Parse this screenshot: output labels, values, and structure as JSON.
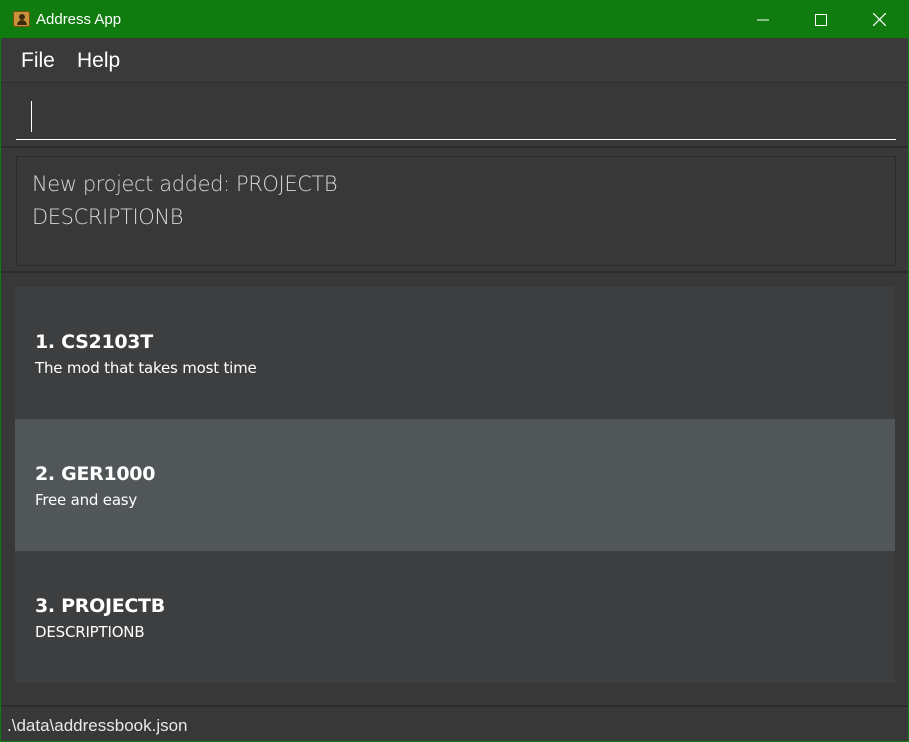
{
  "window": {
    "title": "Address App",
    "accent_color": "#107c10",
    "icons": {
      "app": "contact-book-icon",
      "minimize": "minimize-icon",
      "maximize": "maximize-icon",
      "close": "close-icon"
    }
  },
  "menu": {
    "file_label": "File",
    "help_label": "Help"
  },
  "command": {
    "value": "",
    "placeholder": ""
  },
  "result": {
    "message": "New project added: PROJECTB\nDESCRIPTIONB"
  },
  "projects": [
    {
      "title": "1.  CS2103T",
      "description": "The mod that takes most time"
    },
    {
      "title": "2.  GER1000",
      "description": "Free and easy"
    },
    {
      "title": "3.  PROJECTB",
      "description": "DESCRIPTIONB"
    }
  ],
  "status": {
    "file_path": ".\\data\\addressbook.json"
  }
}
